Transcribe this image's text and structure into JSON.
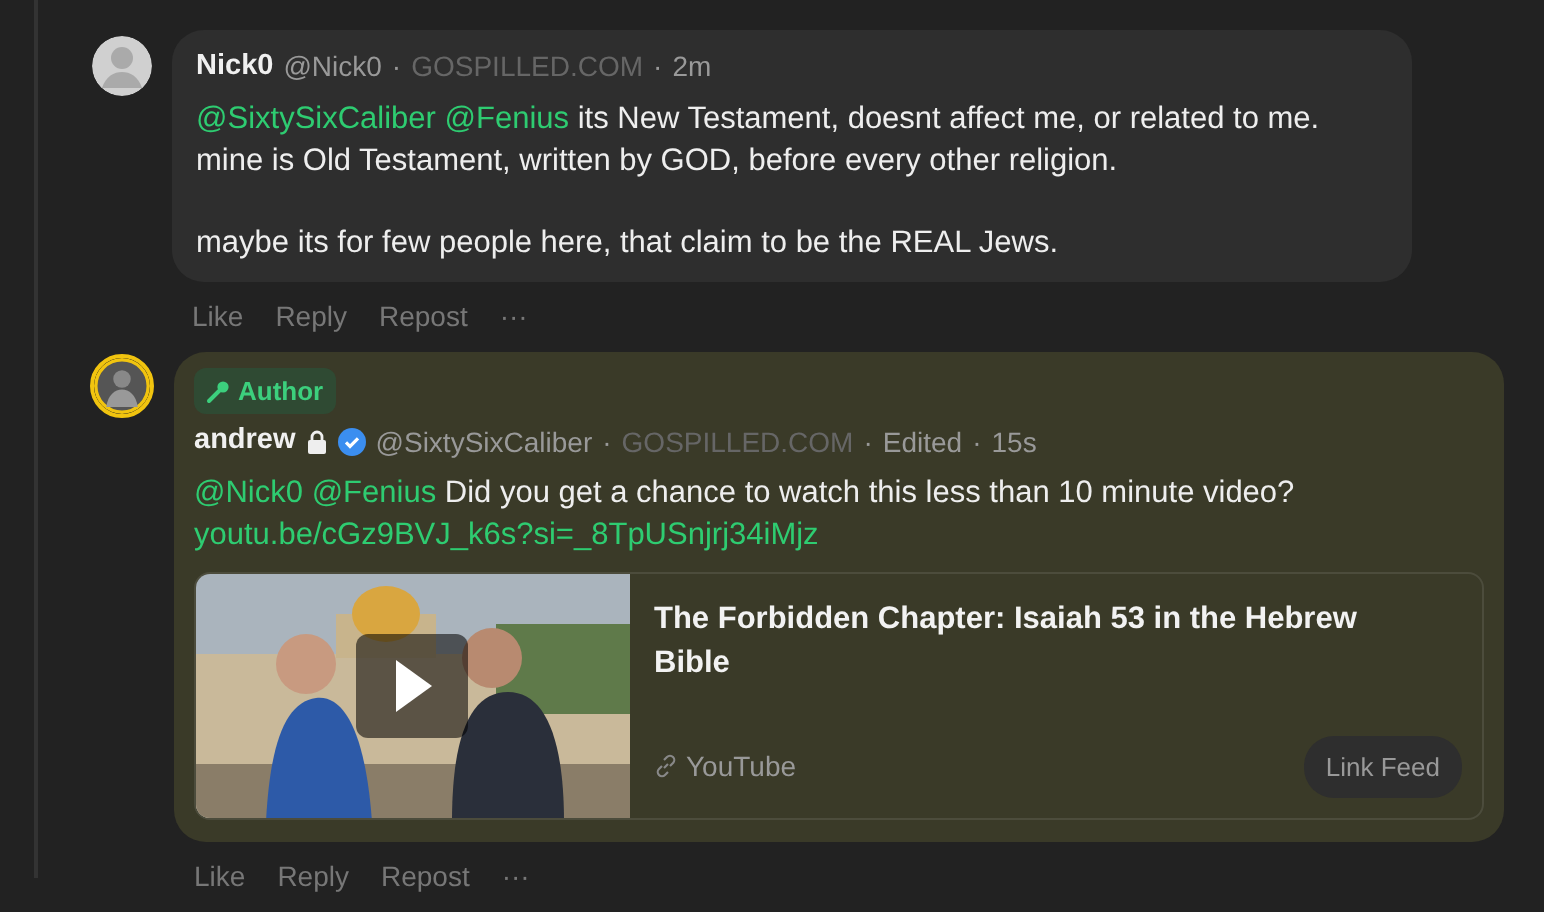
{
  "comments": [
    {
      "author": {
        "name": "Nick0",
        "handle": "@Nick0",
        "locked": false,
        "verified": false
      },
      "meta": [
        "·",
        "GOSPILLED.COM",
        "·",
        "2m"
      ],
      "highlighted": false,
      "paragraphs": [
        [
          [
            {
              "kind": "mention",
              "text": "@SixtySixCaliber"
            },
            {
              "kind": "mention",
              "text": "@Fenius"
            },
            {
              "kind": "text",
              "text": "its New Testament, doesnt affect me, or related to me."
            }
          ],
          [
            {
              "kind": "text",
              "text": "mine is Old Testament, written by GOD, before every other religion."
            }
          ]
        ],
        [
          [
            {
              "kind": "text",
              "text": "maybe its for few people here, that claim to be the REAL Jews."
            }
          ]
        ]
      ],
      "actions": [
        "Like",
        "Reply",
        "Repost",
        "···"
      ]
    },
    {
      "author": {
        "name": "andrew",
        "handle": "@SixtySixCaliber",
        "locked": true,
        "verified": true
      },
      "badge": {
        "label": "Author"
      },
      "meta": [
        "·",
        "GOSPILLED.COM",
        "·",
        "Edited",
        "·",
        "15s"
      ],
      "highlighted": true,
      "paragraphs": [
        [
          [
            {
              "kind": "mention",
              "text": "@Nick0"
            },
            {
              "kind": "mention",
              "text": "@Fenius"
            },
            {
              "kind": "text",
              "text": "Did you get a chance to watch this less than 10 minute video?"
            }
          ],
          [
            {
              "kind": "link",
              "text": "youtu.be/cGz9BVJ_k6s?si=_8TpUSnjrj34iMjz"
            }
          ]
        ]
      ],
      "preview": {
        "kind": "picture",
        "title": "The Forbidden Chapter: Isaiah 53 in the Hebrew Bible",
        "source": "YouTube",
        "button": "Link Feed"
      },
      "actions": [
        "Like",
        "Reply",
        "Repost",
        "···"
      ]
    }
  ]
}
